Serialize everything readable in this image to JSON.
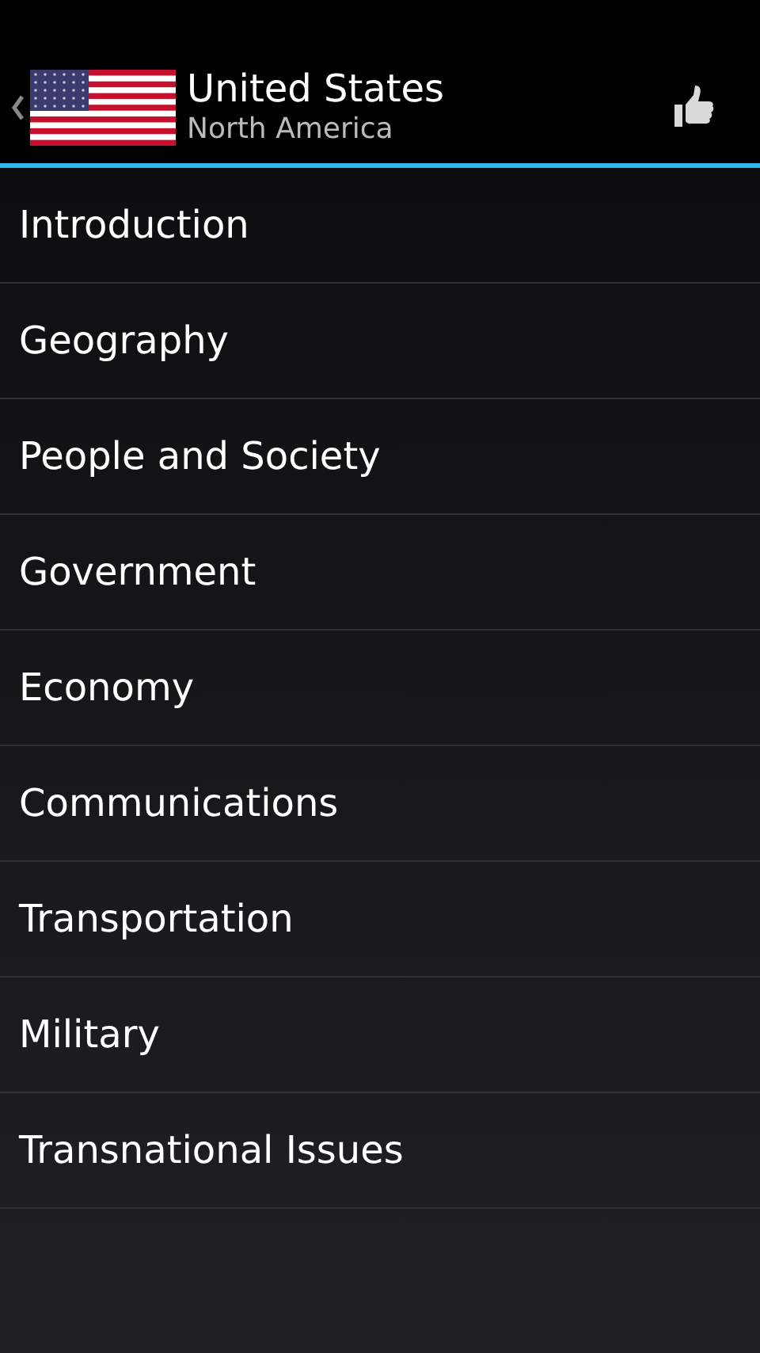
{
  "header": {
    "title": "United States",
    "subtitle": "North America"
  },
  "sections": [
    {
      "label": "Introduction"
    },
    {
      "label": "Geography"
    },
    {
      "label": "People and Society"
    },
    {
      "label": "Government"
    },
    {
      "label": "Economy"
    },
    {
      "label": "Communications"
    },
    {
      "label": "Transportation"
    },
    {
      "label": "Military"
    },
    {
      "label": "Transnational Issues"
    }
  ]
}
